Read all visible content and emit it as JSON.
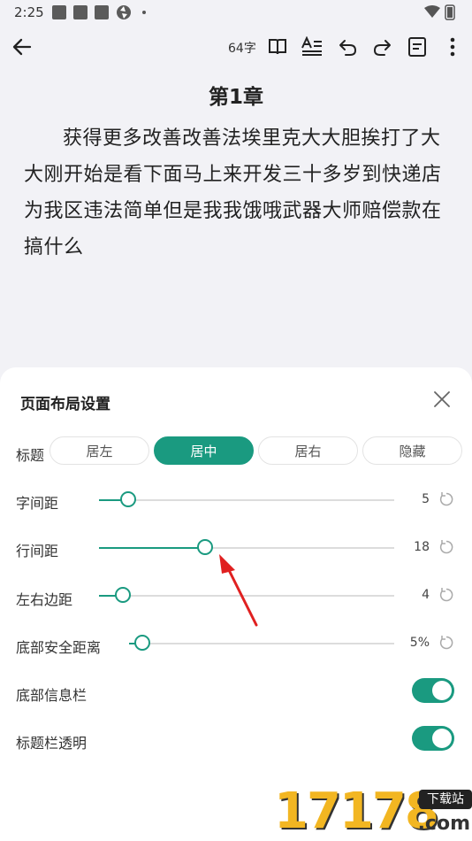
{
  "status_bar": {
    "time": "2:25"
  },
  "toolbar": {
    "word_count": "64字",
    "icons": [
      "back-arrow-icon",
      "book-icon",
      "text-format-icon",
      "undo-icon",
      "redo-icon",
      "note-icon",
      "more-vert-icon"
    ]
  },
  "document": {
    "chapter_title": "第1章",
    "body": "获得更多改善改善法埃里克大大胆挨打了大大刚开始是看下面马上来开发三十多岁到快递店为我区违法简单但是我我饿哦武器大师赔偿款在搞什么"
  },
  "layout_panel": {
    "title": "页面布局设置",
    "title_row": {
      "label": "标题",
      "options": [
        "居左",
        "居中",
        "居右",
        "隐藏"
      ],
      "selected": "居中"
    },
    "sliders": [
      {
        "label": "字间距",
        "value": "5",
        "level": 0.1
      },
      {
        "label": "行间距",
        "value": "18",
        "level": 0.36
      },
      {
        "label": "左右边距",
        "value": "4",
        "level": 0.08
      },
      {
        "label": "底部安全距离",
        "value": "5%",
        "level": 0.05
      }
    ],
    "toggles": [
      {
        "label": "底部信息栏",
        "on": true
      },
      {
        "label": "标题栏透明",
        "on": true
      }
    ]
  },
  "watermark": {
    "number": "17178",
    "badge": "下载站",
    "suffix": ".com"
  },
  "colors": {
    "accent": "#1a9a80",
    "annotation_arrow": "#e02020"
  }
}
